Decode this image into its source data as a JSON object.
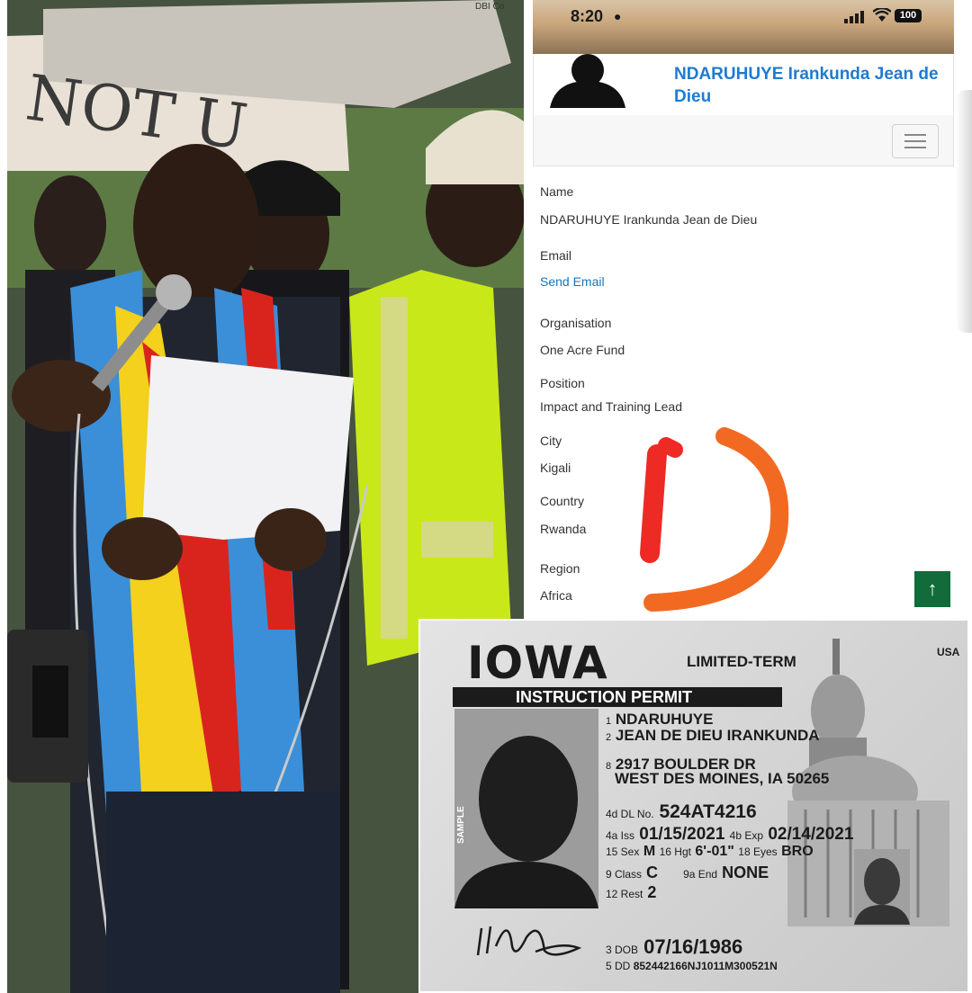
{
  "status_bar": {
    "time": "8:20",
    "battery": "100"
  },
  "profile": {
    "name_heading": "NDARUHUYE Irankunda Jean de Dieu",
    "fields": [
      {
        "label": "Name",
        "value": "NDARUHUYE Irankunda Jean de Dieu"
      },
      {
        "label": "Email",
        "value": "Send Email"
      },
      {
        "label": "Organisation",
        "value": "One Acre Fund"
      },
      {
        "label": "Position",
        "value": "Impact and Training Lead"
      },
      {
        "label": "City",
        "value": "Kigali"
      },
      {
        "label": "Country",
        "value": "Rwanda"
      },
      {
        "label": "Region",
        "value": "Africa"
      }
    ],
    "menu_icon": "hamburger-icon",
    "scroll_top_icon": "arrow-up-icon",
    "colors": {
      "name": "#1f7bd0",
      "link": "#1a73b8",
      "scroll_button": "#116b3a",
      "doodle_red": "#ee2a24",
      "doodle_orange": "#f26a22"
    }
  },
  "photo": {
    "sign_text_top": "DBI Co",
    "sign_text_left": "NOT U"
  },
  "license": {
    "state": "IOWA",
    "type": "LIMITED-TERM",
    "country": "USA",
    "permit": "INSTRUCTION PERMIT",
    "field_1_no": "1",
    "surname": "NDARUHUYE",
    "field_2_no": "2",
    "given_names": "JEAN DE DIEU IRANKUNDA",
    "field_8_no": "8",
    "address_line1": "2917 BOULDER DR",
    "address_line2": "WEST DES MOINES, IA 50265",
    "dl_key": "4d DL No.",
    "dl_no": "524AT4216",
    "iss_key": "4a Iss",
    "iss": "01/15/2021",
    "exp_key": "4b Exp",
    "exp": "02/14/2021",
    "sex_key": "15 Sex",
    "sex": "M",
    "hgt_key": "16 Hgt",
    "hgt": "6'-01\"",
    "eyes_key": "18 Eyes",
    "eyes": "BRO",
    "class_key": "9 Class",
    "class": "C",
    "end_key": "9a End",
    "end": "NONE",
    "rest_key": "12 Rest",
    "rest": "2",
    "dob_key": "3 DOB",
    "dob": "07/16/1986",
    "dd_key": "5 DD",
    "dd": "852442166NJ1011M300521N",
    "sample": "SAMPLE"
  }
}
